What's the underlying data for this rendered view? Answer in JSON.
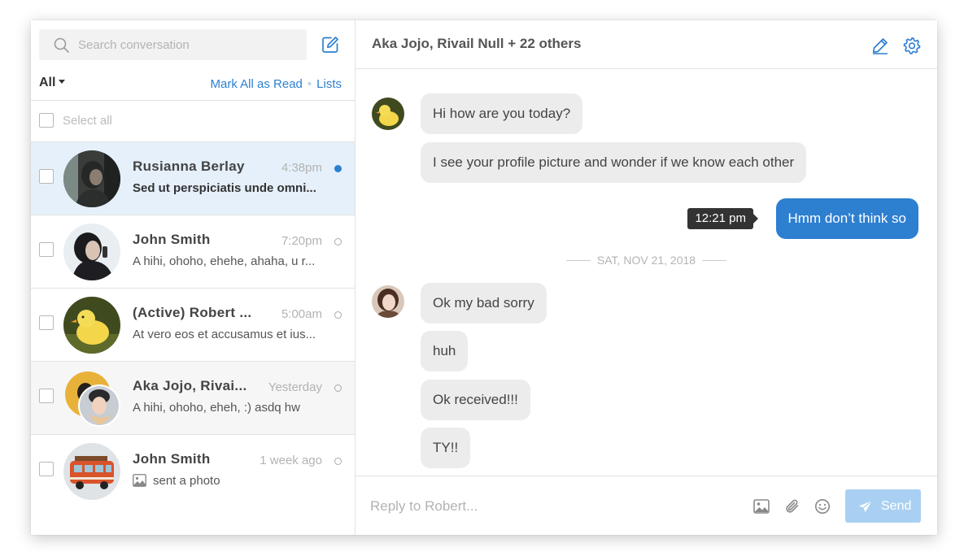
{
  "search": {
    "placeholder": "Search conversation"
  },
  "filter": {
    "all_label": "All",
    "mark_all_read": "Mark All as Read",
    "separator": "•",
    "lists": "Lists",
    "select_all": "Select all"
  },
  "conversations": [
    {
      "name": "Rusianna Berlay",
      "time": "4:38pm",
      "preview": "Sed ut perspiciatis unde omni...",
      "status": "unread",
      "state": "selected"
    },
    {
      "name": "John Smith",
      "time": "7:20pm",
      "preview": "A hihi, ohoho, ehehe, ahaha, u r...",
      "status": "read",
      "state": "normal"
    },
    {
      "name": "(Active) Robert ...",
      "time": "5:00am",
      "preview": "At vero eos et accusamus et ius...",
      "status": "read",
      "state": "normal"
    },
    {
      "name": "Aka Jojo, Rivai...",
      "time": "Yesterday",
      "preview": "A hihi, ohoho, eheh, :) asdq hw",
      "status": "read",
      "state": "hover"
    },
    {
      "name": "John Smith",
      "time": "1 week ago",
      "preview": "sent a photo",
      "status": "read",
      "state": "normal",
      "preview_icon": "photo-icon"
    }
  ],
  "chat": {
    "title": "Aka Jojo, Rivail Null + 22 others",
    "header_icons": [
      "pencil-icon",
      "gear-icon"
    ],
    "messages": [
      {
        "text": "Hi how are you today?",
        "direction": "in"
      },
      {
        "text": "I see your profile picture and wonder if we know each other",
        "direction": "in"
      },
      {
        "text": "Hmm don’t think so",
        "direction": "out",
        "tooltip": "12:21 pm"
      },
      {
        "text": "Ok my bad sorry",
        "direction": "in"
      },
      {
        "text": "huh",
        "direction": "in"
      },
      {
        "text": "Ok received!!!",
        "direction": "in"
      },
      {
        "text": "TY!!",
        "direction": "in"
      }
    ],
    "date_separator": "SAT, NOV 21, 2018"
  },
  "composer": {
    "placeholder": "Reply to Robert...",
    "icons": [
      "image-icon",
      "paperclip-icon",
      "emoji-icon"
    ],
    "send_label": "Send"
  },
  "colors": {
    "accent": "#2d7fd0",
    "selected_row": "#e5f0fa",
    "send_disabled": "#a9d0f2",
    "bubble_in": "#ececec"
  }
}
